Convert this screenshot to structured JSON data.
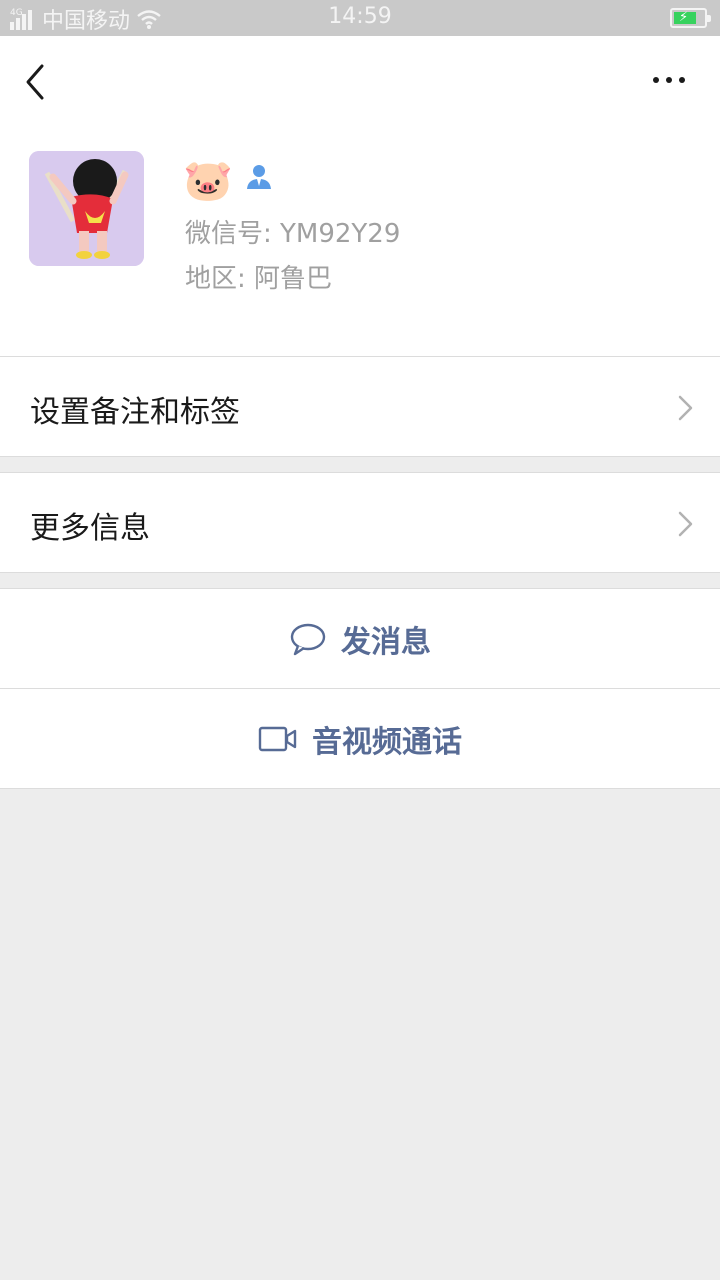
{
  "status_bar": {
    "network": "4G",
    "carrier": "中国移动",
    "time": "14:59",
    "battery_color": "#37d25e"
  },
  "nav": {
    "back_icon": "chevron-left-icon",
    "more_icon": "more-dots-icon"
  },
  "profile": {
    "nickname": "🐷",
    "gender_icon": "person-icon",
    "wechat_id": "微信号: YM92Y29",
    "region": "地区: 阿鲁巴"
  },
  "menu": {
    "remark_tags": "设置备注和标签",
    "more_info": "更多信息"
  },
  "actions": {
    "send_message": "发消息",
    "video_call": "音视频通话",
    "accent_color": "#576b95"
  }
}
